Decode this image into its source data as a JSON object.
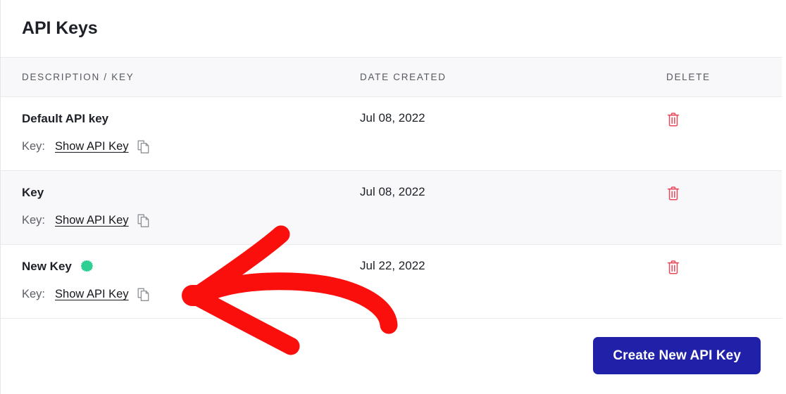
{
  "page": {
    "title": "API Keys"
  },
  "table": {
    "headers": {
      "description": "DESCRIPTION / KEY",
      "date_created": "DATE CREATED",
      "delete": "DELETE"
    },
    "key_label": "Key:",
    "show_key_label": "Show API Key",
    "copy_icon": "copy-icon",
    "delete_icon": "trash-icon",
    "new_badge_icon": "new-starburst-badge-icon",
    "rows": [
      {
        "name": "Default API key",
        "date": "Jul 08, 2022",
        "is_new": false
      },
      {
        "name": "Key",
        "date": "Jul 08, 2022",
        "is_new": false
      },
      {
        "name": "New Key",
        "date": "Jul 22, 2022",
        "is_new": true
      }
    ]
  },
  "footer": {
    "create_button": "Create New API Key"
  },
  "annotation": {
    "type": "hand-drawn-arrow",
    "direction": "left",
    "color": "#fa0f0c"
  },
  "colors": {
    "primary_button": "#2020a8",
    "delete_icon": "#e8485a",
    "new_badge": "#2ecf92",
    "annotation_red": "#fa0f0c",
    "row_alt_background": "#f8f8fa",
    "header_background": "#f8f8fa"
  }
}
